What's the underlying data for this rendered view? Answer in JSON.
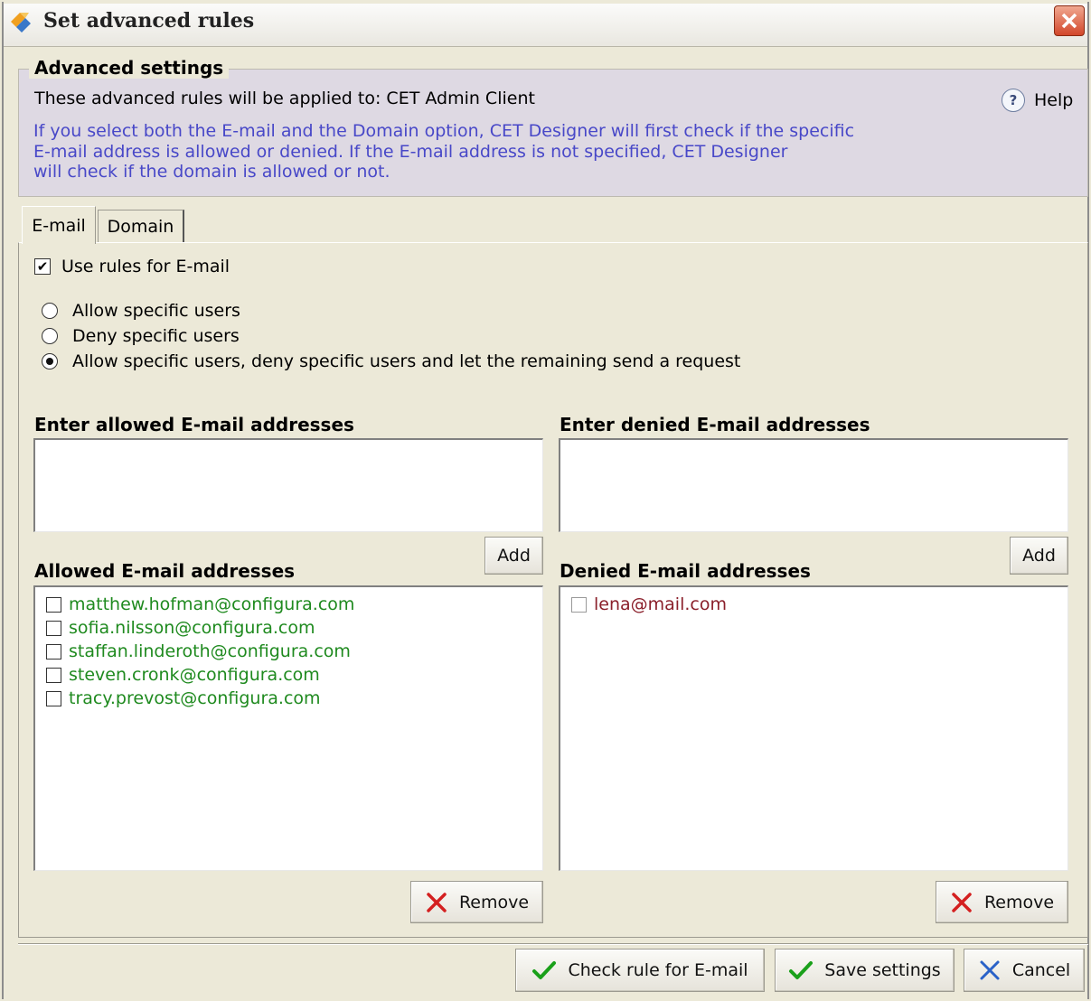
{
  "window": {
    "title": "Set advanced rules"
  },
  "advanced": {
    "legend": "Advanced settings",
    "applied_to": "These advanced rules will be applied to: CET Admin Client",
    "help_label": "Help",
    "info_line1": "If you select both the E-mail and the Domain option, CET Designer will first check if the specific",
    "info_line2": "E-mail address is allowed or denied. If the E-mail address is not specified, CET Designer",
    "info_line3": "will check if the domain is allowed or not."
  },
  "tabs": [
    {
      "label": "E-mail",
      "active": true
    },
    {
      "label": "Domain",
      "active": false
    }
  ],
  "email_tab": {
    "use_rules_label": "Use rules for E-mail",
    "use_rules_checked": true,
    "radio_options": [
      {
        "label": "Allow specific users",
        "selected": false
      },
      {
        "label": "Deny specific users",
        "selected": false
      },
      {
        "label": "Allow specific users, deny specific users and let the remaining send a request",
        "selected": true
      }
    ],
    "enter_allowed_label": "Enter allowed E-mail addresses",
    "enter_denied_label": "Enter denied E-mail addresses",
    "allowed_input_value": "",
    "denied_input_value": "",
    "add_label": "Add",
    "allowed_list_label": "Allowed E-mail addresses",
    "denied_list_label": "Denied E-mail addresses",
    "allowed_list": [
      "matthew.hofman@configura.com",
      "sofia.nilsson@configura.com",
      "staffan.linderoth@configura.com",
      "steven.cronk@configura.com",
      "tracy.prevost@configura.com"
    ],
    "denied_list": [
      "lena@mail.com"
    ],
    "remove_label": "Remove"
  },
  "footer": {
    "check_rule_label": "Check rule for E-mail",
    "save_label": "Save settings",
    "cancel_label": "Cancel"
  },
  "colors": {
    "info_text": "#4848c8",
    "allowed_text": "#1f8a1f",
    "denied_text": "#8a1f2a",
    "check_icon": "#1aa01a",
    "remove_icon": "#d42020",
    "cancel_icon": "#2a62c8"
  }
}
